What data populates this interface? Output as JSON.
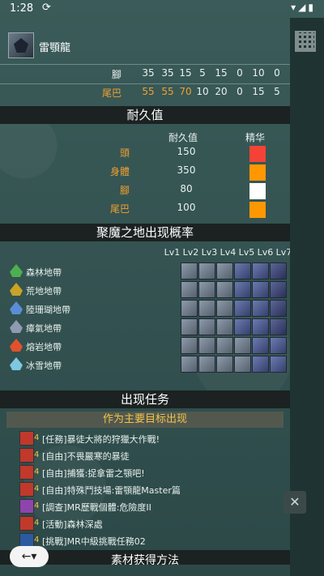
{
  "status": {
    "time": "1:28",
    "sync_icon": "sync-icon"
  },
  "monster": {
    "name": "雷顎龍"
  },
  "hitzones": [
    {
      "label": "腳",
      "values": [
        "35",
        "35",
        "15",
        "5",
        "15",
        "0",
        "10",
        "0"
      ],
      "highlight": false
    },
    {
      "label": "尾巴",
      "values": [
        "55",
        "55",
        "70",
        "10",
        "20",
        "0",
        "15",
        "5"
      ],
      "highlight": true
    }
  ],
  "durability": {
    "title": "耐久值",
    "col_value": "耐久值",
    "col_essence": "精华",
    "rows": [
      {
        "part": "頭",
        "value": "150",
        "color": "#f44336"
      },
      {
        "part": "身體",
        "value": "350",
        "color": "#ff9800"
      },
      {
        "part": "腳",
        "value": "80",
        "color": "#ffffff"
      },
      {
        "part": "尾巴",
        "value": "100",
        "color": "#ff9800"
      }
    ]
  },
  "gathering": {
    "title": "聚魔之地出现概率",
    "levels": [
      "Lv1",
      "Lv2",
      "Lv3",
      "Lv4",
      "Lv5",
      "Lv6",
      "Lv7"
    ],
    "zones": [
      {
        "name": "森林地帶",
        "color": "#4caf50",
        "tiles": [
          "a",
          "a",
          "a",
          "b",
          "b",
          "c"
        ]
      },
      {
        "name": "荒地地帶",
        "color": "#c9a227",
        "tiles": [
          "a",
          "a",
          "a",
          "b",
          "b",
          "c"
        ]
      },
      {
        "name": "陸珊瑚地帶",
        "color": "#5b8dd6",
        "tiles": [
          "a",
          "a",
          "a",
          "b",
          "b",
          "c"
        ]
      },
      {
        "name": "瘴氣地帶",
        "color": "#8f9bb0",
        "tiles": [
          "a",
          "a",
          "a",
          "b",
          "b",
          "c"
        ]
      },
      {
        "name": "熔岩地帶",
        "color": "#e0522d",
        "tiles": [
          "a",
          "a",
          "a",
          "a",
          "b",
          "b"
        ]
      },
      {
        "name": "冰雪地帶",
        "color": "#7ec8e3",
        "tiles": [
          "a",
          "a",
          "a",
          "a",
          "b",
          "b"
        ]
      }
    ]
  },
  "quests": {
    "title": "出现任务",
    "subtitle": "作为主要目标出现",
    "items": [
      {
        "stars": "4",
        "text": "[任務]暴徒大將的狩獵大作戰!",
        "icon_color": "#c0392b"
      },
      {
        "stars": "4",
        "text": "[自由]不畏嚴寒的暴徒",
        "icon_color": "#c0392b"
      },
      {
        "stars": "4",
        "text": "[自由]捕獲:捉拿雷之顎吧!",
        "icon_color": "#c0392b"
      },
      {
        "stars": "4",
        "text": "[自由]特殊鬥技場:雷顎龍Master篇",
        "icon_color": "#c0392b"
      },
      {
        "stars": "4",
        "text": "[調查]MR歷戰個體:危險度II",
        "icon_color": "#8e44ad"
      },
      {
        "stars": "4",
        "text": "[活動]森林深處",
        "icon_color": "#c0392b"
      },
      {
        "stars": "4",
        "text": "[挑戰]MR中級挑戰任務02",
        "icon_color": "#2c5aa0"
      }
    ]
  },
  "bottom_section": {
    "title": "素材获得方法"
  },
  "nav": {
    "back_label": "←▾"
  }
}
